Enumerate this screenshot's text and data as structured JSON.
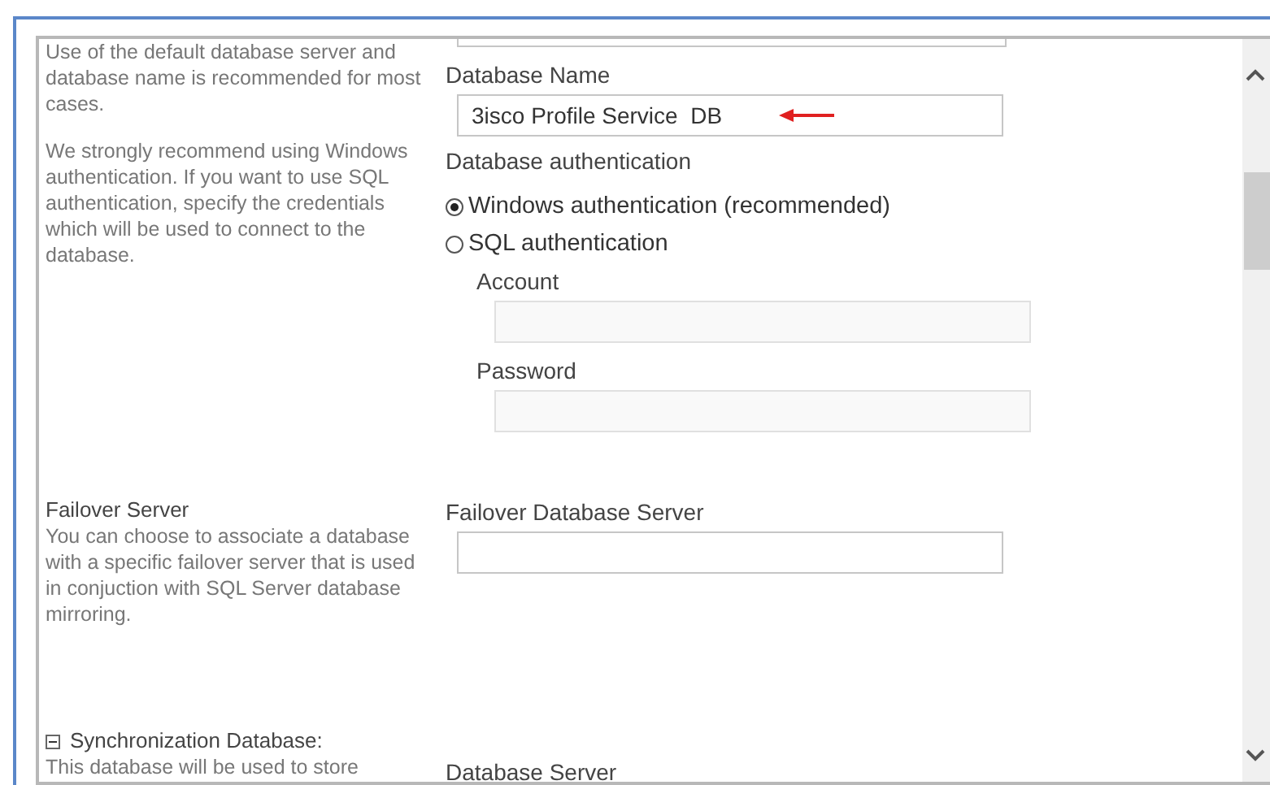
{
  "sections": [
    {
      "paragraphs": [
        "Use of the default database server and database name is recommended for most cases.",
        "We strongly recommend using Windows authentication. If you want to use SQL authentication, specify the credentials which will be used to connect to the database."
      ],
      "fields": [
        {
          "kind": "ghost"
        },
        {
          "kind": "input",
          "label": "Database Name",
          "value": "3isco Profile Service  DB",
          "disabled": false,
          "annotated": true
        },
        {
          "kind": "radios",
          "label": "Database authentication",
          "options": [
            {
              "label": "Windows authentication (recommended)",
              "selected": true
            },
            {
              "label": "SQL authentication",
              "selected": false
            }
          ]
        },
        {
          "kind": "subinput",
          "label": "Account",
          "disabled": true
        },
        {
          "kind": "subinput",
          "label": "Password",
          "disabled": true
        }
      ]
    },
    {
      "title": "Failover Server",
      "paragraphs": [
        "You can choose to associate a database with a specific failover server that is used in conjuction with SQL Server database mirroring."
      ],
      "fields": [
        {
          "kind": "input",
          "label": "Failover Database Server",
          "disabled": false
        }
      ]
    },
    {
      "title": "Synchronization Database:",
      "expanded": true,
      "paragraphs": [
        "This database will be used to store"
      ],
      "fields": [
        {
          "kind": "label",
          "label": "Database Server"
        }
      ]
    }
  ]
}
